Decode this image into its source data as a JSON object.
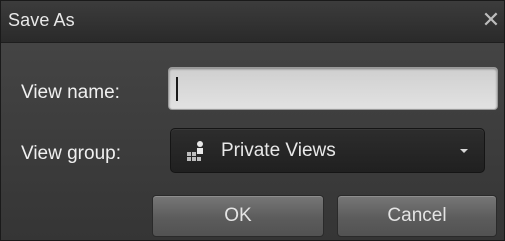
{
  "dialog": {
    "title": "Save As",
    "close_glyph": "✕",
    "view_name": {
      "label": "View name:",
      "value": ""
    },
    "view_group": {
      "label": "View group:",
      "selected": "Private Views",
      "icon": "private-views-icon"
    },
    "buttons": {
      "ok": "OK",
      "cancel": "Cancel"
    }
  }
}
